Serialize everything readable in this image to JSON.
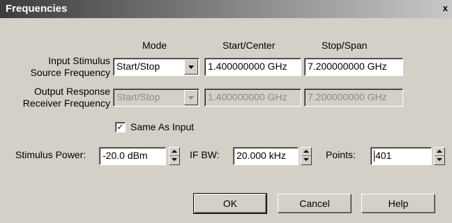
{
  "window": {
    "title": "Frequencies",
    "close_glyph": "x"
  },
  "columns": {
    "mode": "Mode",
    "start_center": "Start/Center",
    "stop_span": "Stop/Span"
  },
  "input_row": {
    "label_line1": "Input Stimulus",
    "label_line2": "Source Frequency",
    "mode": "Start/Stop",
    "start": "1.400000000 GHz",
    "stop": "7.200000000 GHz"
  },
  "output_row": {
    "label_line1": "Output Response",
    "label_line2": "Receiver Frequency",
    "mode": "Start/Stop",
    "start": "1.400000000 GHz",
    "stop": "7.200000000 GHz"
  },
  "same_as_input": {
    "label": "Same As Input",
    "checked": true,
    "check_glyph": "✓"
  },
  "stimulus_power": {
    "label": "Stimulus Power:",
    "value": "-20.0 dBm"
  },
  "if_bw": {
    "label": "IF BW:",
    "value": "20.000 kHz"
  },
  "points": {
    "label": "Points:",
    "value": "401"
  },
  "buttons": {
    "ok": "OK",
    "cancel": "Cancel",
    "help": "Help"
  },
  "icons": {
    "close": "close-icon",
    "dropdown": "chevron-down-icon",
    "spin_up": "arrow-up-icon",
    "spin_down": "arrow-down-icon",
    "check": "checkmark-icon"
  },
  "colors": {
    "dialog_bg": "#d4d0c8",
    "title_start": "#3d3d3d",
    "title_end": "#c8c8c8",
    "disabled_text": "#8a8a8a"
  }
}
